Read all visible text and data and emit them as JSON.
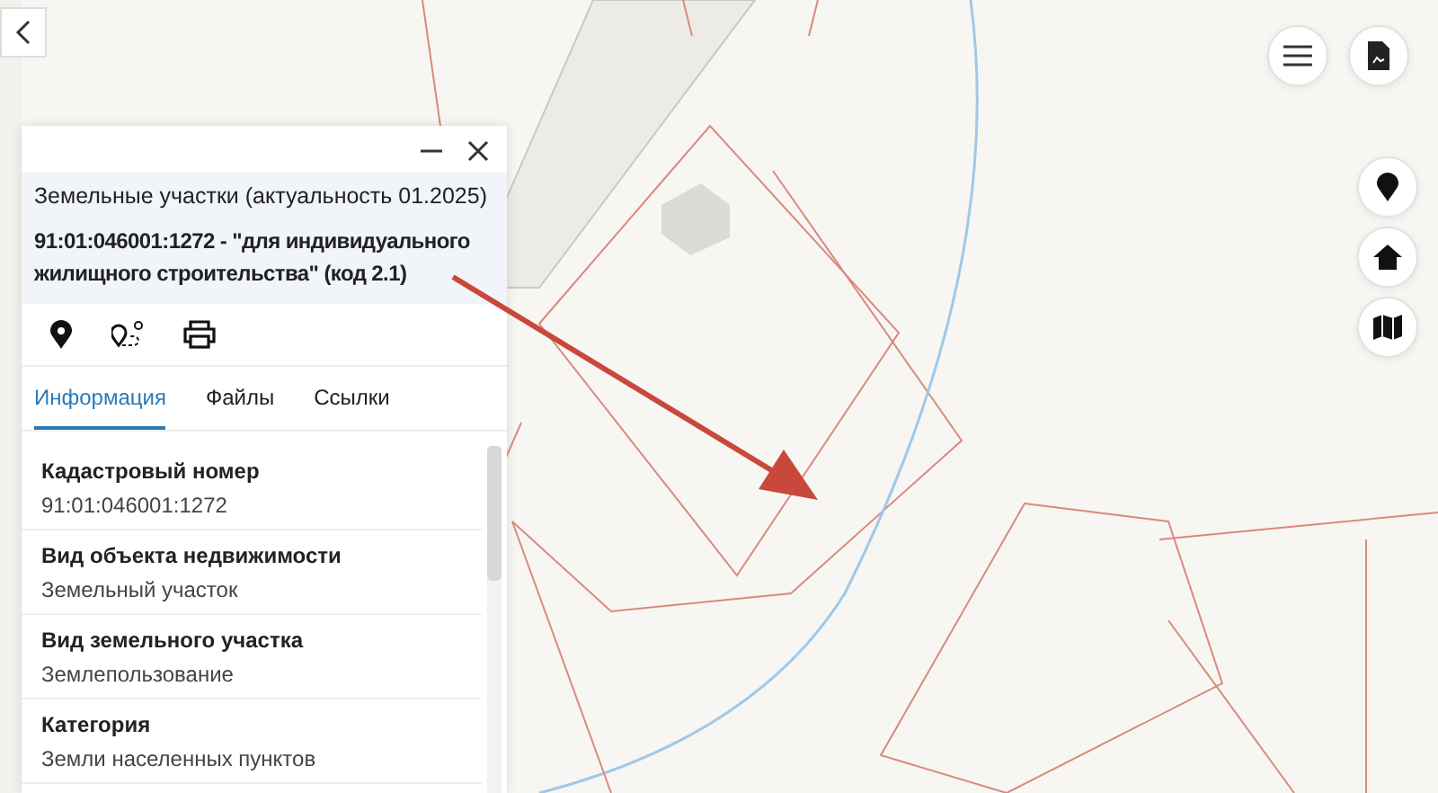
{
  "panel": {
    "title": "Земельные участки (актуальность 01.2025)",
    "heading": "91:01:046001:1272 - \"для индивидуального жилищного строительства\" (код 2.1)",
    "tabs": [
      {
        "label": "Информация",
        "selected": true
      },
      {
        "label": "Файлы",
        "selected": false
      },
      {
        "label": "Ссылки",
        "selected": false
      }
    ],
    "fields": [
      {
        "label": "Кадастровый номер",
        "value": "91:01:046001:1272"
      },
      {
        "label": "Вид объекта недвижимости",
        "value": "Земельный участок"
      },
      {
        "label": "Вид земельного участка",
        "value": "Землепользование"
      },
      {
        "label": "Категория",
        "value": "Земли населенных пунктов"
      }
    ]
  }
}
